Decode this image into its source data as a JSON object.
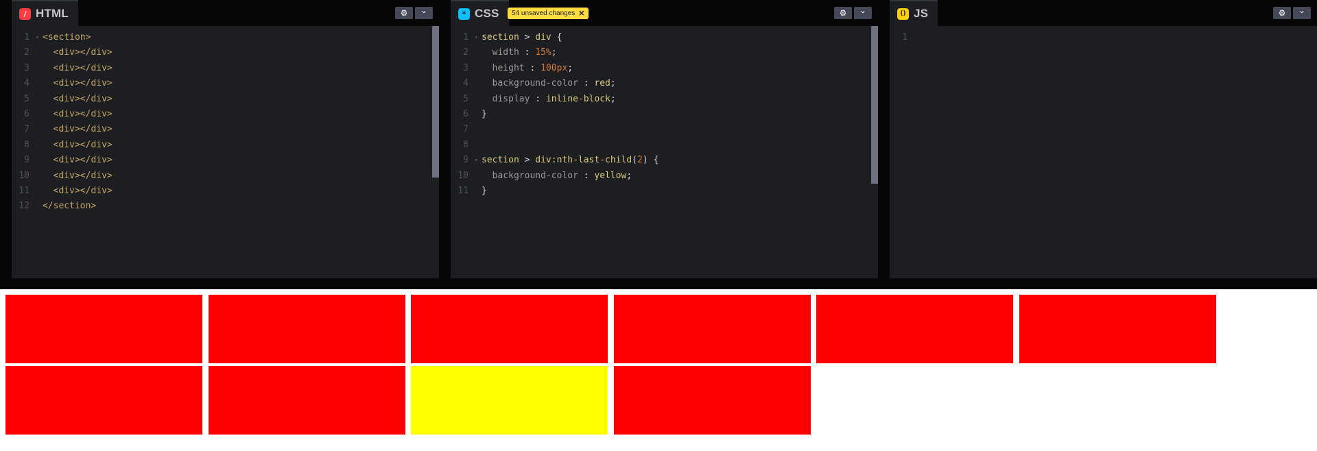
{
  "html_panel": {
    "title": "HTML",
    "icon": "slash-icon",
    "icon_glyph": "/",
    "icon_color": "#ff3c41",
    "lines": [
      {
        "num": "1",
        "code": "<section>",
        "fold": true
      },
      {
        "num": "2",
        "code": "  <div></div>"
      },
      {
        "num": "3",
        "code": "  <div></div>"
      },
      {
        "num": "4",
        "code": "  <div></div>"
      },
      {
        "num": "5",
        "code": "  <div></div>"
      },
      {
        "num": "6",
        "code": "  <div></div>"
      },
      {
        "num": "7",
        "code": "  <div></div>"
      },
      {
        "num": "8",
        "code": "  <div></div>"
      },
      {
        "num": "9",
        "code": "  <div></div>"
      },
      {
        "num": "10",
        "code": "  <div></div>"
      },
      {
        "num": "11",
        "code": "  <div></div>"
      },
      {
        "num": "12",
        "code": "</section>"
      }
    ]
  },
  "css_panel": {
    "title": "CSS",
    "icon": "asterisk-icon",
    "icon_glyph": "*",
    "icon_color": "#0ebeff",
    "unsaved_label": "54 unsaved changes",
    "unsaved_close": "✕",
    "lines": [
      {
        "num": "1",
        "fold": true,
        "tokens": [
          [
            "section",
            "sel"
          ],
          [
            " > ",
            "op"
          ],
          [
            "div",
            "sel"
          ],
          [
            " {",
            "punc"
          ]
        ]
      },
      {
        "num": "2",
        "tokens": [
          [
            "  width",
            "prop"
          ],
          [
            " : ",
            "punc"
          ],
          [
            "15%",
            "num"
          ],
          [
            ";",
            "punc"
          ]
        ]
      },
      {
        "num": "3",
        "tokens": [
          [
            "  height",
            "prop"
          ],
          [
            " : ",
            "punc"
          ],
          [
            "100px",
            "num"
          ],
          [
            ";",
            "punc"
          ]
        ]
      },
      {
        "num": "4",
        "tokens": [
          [
            "  background-color",
            "prop"
          ],
          [
            " : ",
            "punc"
          ],
          [
            "red",
            "val"
          ],
          [
            ";",
            "punc"
          ]
        ]
      },
      {
        "num": "5",
        "tokens": [
          [
            "  display",
            "prop"
          ],
          [
            " : ",
            "punc"
          ],
          [
            "inline-block",
            "val"
          ],
          [
            ";",
            "punc"
          ]
        ]
      },
      {
        "num": "6",
        "tokens": [
          [
            "}",
            "punc"
          ]
        ]
      },
      {
        "num": "7",
        "tokens": []
      },
      {
        "num": "8",
        "tokens": []
      },
      {
        "num": "9",
        "fold": true,
        "tokens": [
          [
            "section",
            "sel"
          ],
          [
            " > ",
            "op"
          ],
          [
            "div:nth-last-child",
            "sel"
          ],
          [
            "(",
            "punc"
          ],
          [
            "2",
            "num"
          ],
          [
            ") {",
            "punc"
          ]
        ]
      },
      {
        "num": "10",
        "tokens": [
          [
            "  background-color",
            "prop"
          ],
          [
            " : ",
            "punc"
          ],
          [
            "yellow",
            "val"
          ],
          [
            ";",
            "punc"
          ]
        ]
      },
      {
        "num": "11",
        "tokens": [
          [
            "}",
            "punc"
          ]
        ]
      }
    ]
  },
  "js_panel": {
    "title": "JS",
    "icon": "braces-icon",
    "icon_glyph": "()",
    "icon_color": "#fcd000",
    "lines": [
      {
        "num": "1",
        "code": ""
      }
    ]
  },
  "header_buttons": {
    "settings_icon": "gear-icon",
    "settings_glyph": "⚙",
    "collapse_icon": "chevron-down-icon",
    "collapse_glyph": "⌄"
  },
  "syntax_colors": {
    "tag": "#c5a567",
    "sel": "#ddca7e",
    "op": "#d6d6d6",
    "prop": "#9a9a9a",
    "punc": "#d6d6d6",
    "num": "#d47b38",
    "val": "#ddca7e"
  },
  "preview": {
    "boxes": [
      {
        "color": "#ff0000"
      },
      {
        "color": "#ff0000"
      },
      {
        "color": "#ff0000"
      },
      {
        "color": "#ff0000"
      },
      {
        "color": "#ff0000"
      },
      {
        "color": "#ff0000"
      },
      {
        "color": "#ff0000"
      },
      {
        "color": "#ff0000"
      },
      {
        "color": "#ffff00"
      },
      {
        "color": "#ff0000"
      }
    ]
  }
}
